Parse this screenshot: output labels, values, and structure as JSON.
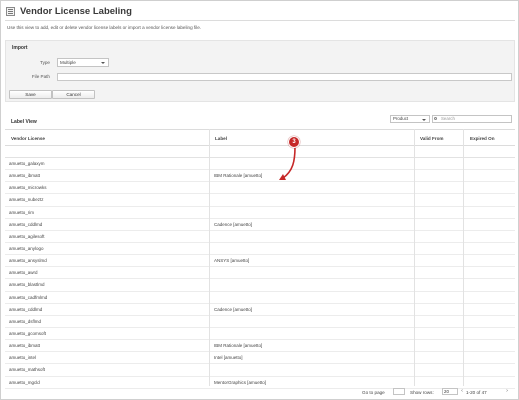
{
  "page": {
    "title": "Vendor License Labeling",
    "intro": "Use this view to add, edit or delete vendor license labels or import a vendor license labeling file."
  },
  "import": {
    "title": "Import",
    "type_label": "Type",
    "type_value": "Multiple",
    "file_label": "File Path",
    "save_label": "Save",
    "cancel_label": "Cancel"
  },
  "label_view": {
    "title": "Label View",
    "filter_value": "Product",
    "search_placeholder": "Search"
  },
  "table": {
    "headers": {
      "vendor_license": "Vendor License",
      "label": "Label",
      "valid_from": "Valid From",
      "expired_on": "Expired On"
    },
    "rows": [
      {
        "vendor_license": "amuetto_galaxym",
        "label": ""
      },
      {
        "vendor_license": "amuetto_ibmatt",
        "label": "IBM Rationale [amuetto]"
      },
      {
        "vendor_license": "amuetto_microwks",
        "label": ""
      },
      {
        "vendor_license": "amuetto_nubeztz",
        "label": ""
      },
      {
        "vendor_license": "amuetto_rim",
        "label": ""
      },
      {
        "vendor_license": "amuetto_cddlmd",
        "label": "Cadence [amuetto]"
      },
      {
        "vendor_license": "amuetto_agilesoft",
        "label": ""
      },
      {
        "vendor_license": "amuetto_anylogo",
        "label": ""
      },
      {
        "vendor_license": "amuetto_ansyslmd",
        "label": "ANSYS [amuetto]"
      },
      {
        "vendor_license": "amuetto_awrd",
        "label": ""
      },
      {
        "vendor_license": "amuetto_blastlmd",
        "label": ""
      },
      {
        "vendor_license": "amuetto_cadfmlmd",
        "label": ""
      },
      {
        "vendor_license": "amuetto_cddlmd",
        "label": "Cadence [amuetto]"
      },
      {
        "vendor_license": "amuetto_dsflmd",
        "label": ""
      },
      {
        "vendor_license": "amuetto_gcomsoft",
        "label": ""
      },
      {
        "vendor_license": "amuetto_ibmatt",
        "label": "IBM Rationale [amuetto]"
      },
      {
        "vendor_license": "amuetto_intel",
        "label": "Intel [amuetto]"
      },
      {
        "vendor_license": "amuetto_mathsoft",
        "label": ""
      },
      {
        "vendor_license": "amuetto_mgcld",
        "label": "MentorGraphics [amuetto]"
      }
    ]
  },
  "pager": {
    "goto_label": "Go to page",
    "show_rows_label": "Show rows:",
    "rows_value": "20",
    "range_text": "1-20 of 47"
  },
  "callout": {
    "number": "3",
    "color": "#c62828"
  }
}
